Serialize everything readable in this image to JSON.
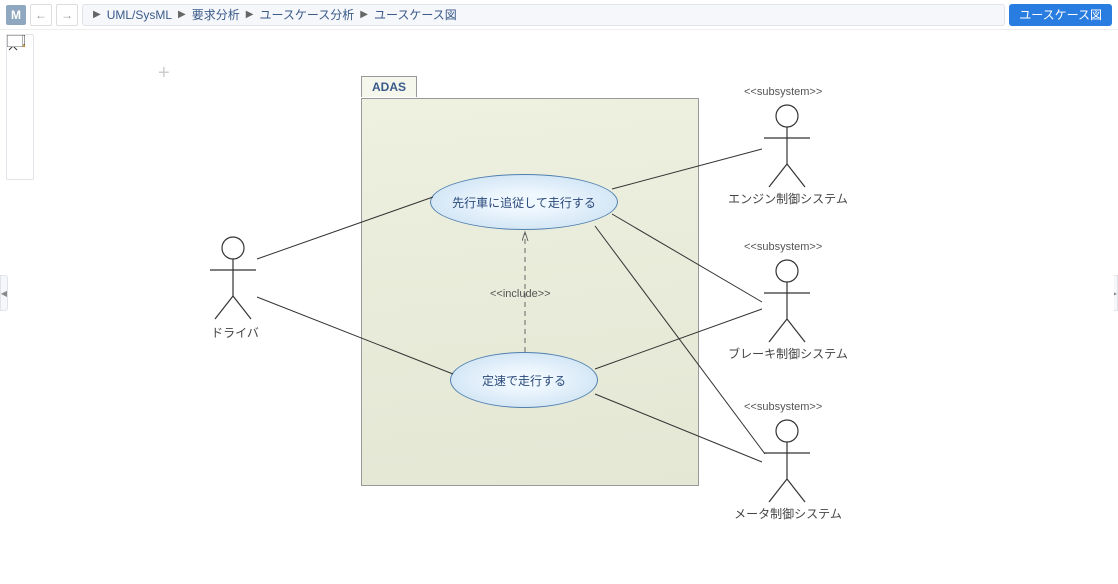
{
  "toolbar": {
    "app_badge": "M",
    "breadcrumb": [
      "UML/SysML",
      "要求分析",
      "ユースケース分析",
      "ユースケース図"
    ],
    "top_right_button": "ユースケース図"
  },
  "palette": {
    "items": [
      {
        "name": "folder-icon"
      },
      {
        "name": "usecase-icon"
      },
      {
        "name": "actor-icon"
      },
      {
        "name": "package-icon"
      },
      {
        "name": "boundary-icon"
      },
      {
        "name": "note-icon"
      }
    ]
  },
  "diagram": {
    "subject_name": "ADAS",
    "usecases": {
      "uc1": "先行車に追従して走行する",
      "uc2": "定速で走行する"
    },
    "include_label": "<<include>>",
    "actors": {
      "driver": {
        "label": "ドライバ",
        "stereotype": ""
      },
      "engine": {
        "label": "エンジン制御システム",
        "stereotype": "<<subsystem>>"
      },
      "brake": {
        "label": "ブレーキ制御システム",
        "stereotype": "<<subsystem>>"
      },
      "meter": {
        "label": "メータ制御システム",
        "stereotype": "<<subsystem>>"
      }
    }
  }
}
